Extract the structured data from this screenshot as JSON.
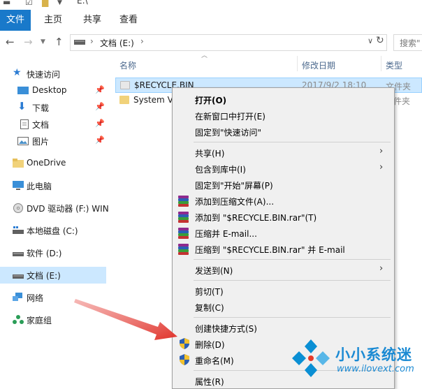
{
  "window": {
    "path": "E:\\"
  },
  "ribbon": {
    "tabs": [
      "文件",
      "主页",
      "共享",
      "查看"
    ]
  },
  "address": {
    "crumb": "文档 (E:)",
    "search_placeholder": "搜索\""
  },
  "nav": {
    "items": [
      {
        "label": "快速访问",
        "icon": "star-icon"
      },
      {
        "label": "Desktop",
        "icon": "desktop-icon",
        "pinned": true
      },
      {
        "label": "下载",
        "icon": "download-arrow-icon",
        "pinned": true
      },
      {
        "label": "文档",
        "icon": "document-icon",
        "pinned": true
      },
      {
        "label": "图片",
        "icon": "picture-icon",
        "pinned": true
      },
      {
        "label": "OneDrive",
        "icon": "folder-icon"
      },
      {
        "label": "此电脑",
        "icon": "computer-icon"
      },
      {
        "label": "DVD 驱动器 (F:) WIN",
        "icon": "dvd-icon"
      },
      {
        "label": "本地磁盘 (C:)",
        "icon": "drive-icon"
      },
      {
        "label": "软件 (D:)",
        "icon": "drive-icon"
      },
      {
        "label": "文档 (E:)",
        "icon": "drive-icon",
        "selected": true
      },
      {
        "label": "网络",
        "icon": "network-icon"
      },
      {
        "label": "家庭组",
        "icon": "homegroup-icon"
      }
    ]
  },
  "files": {
    "columns": {
      "name": "名称",
      "date": "修改日期",
      "type": "类型"
    },
    "rows": [
      {
        "name": "$RECYCLE.BIN",
        "date": "2017/9/2 18:10",
        "type": "文件夹",
        "selected": true
      },
      {
        "name": "System Vo",
        "date": "",
        "type": "文件夹"
      }
    ]
  },
  "context_menu": {
    "items": [
      {
        "label": "打开(O)",
        "bold": true
      },
      {
        "label": "在新窗口中打开(E)"
      },
      {
        "label": "固定到\"快速访问\""
      },
      {
        "label": "共享(H)",
        "submenu": true
      },
      {
        "label": "包含到库中(I)",
        "submenu": true
      },
      {
        "label": "固定到\"开始\"屏幕(P)"
      },
      {
        "label": "添加到压缩文件(A)...",
        "icon": "winrar-icon"
      },
      {
        "label": "添加到 \"$RECYCLE.BIN.rar\"(T)",
        "icon": "winrar-icon"
      },
      {
        "label": "压缩并 E-mail...",
        "icon": "winrar-icon"
      },
      {
        "label": "压缩到 \"$RECYCLE.BIN.rar\" 并 E-mail",
        "icon": "winrar-icon"
      },
      {
        "label": "发送到(N)",
        "submenu": true
      },
      {
        "label": "剪切(T)"
      },
      {
        "label": "复制(C)"
      },
      {
        "label": "创建快捷方式(S)"
      },
      {
        "label": "删除(D)",
        "icon": "shield-icon"
      },
      {
        "label": "重命名(M)",
        "icon": "shield-icon"
      },
      {
        "label": "属性(R)"
      }
    ]
  },
  "watermark": {
    "text": "小小系统迷",
    "url": "www.ilovext.com"
  },
  "colors": {
    "accent": "#1979ca",
    "selection": "#cce8ff",
    "arrow": "#e0322a",
    "watermark": "#1b8ad3"
  }
}
